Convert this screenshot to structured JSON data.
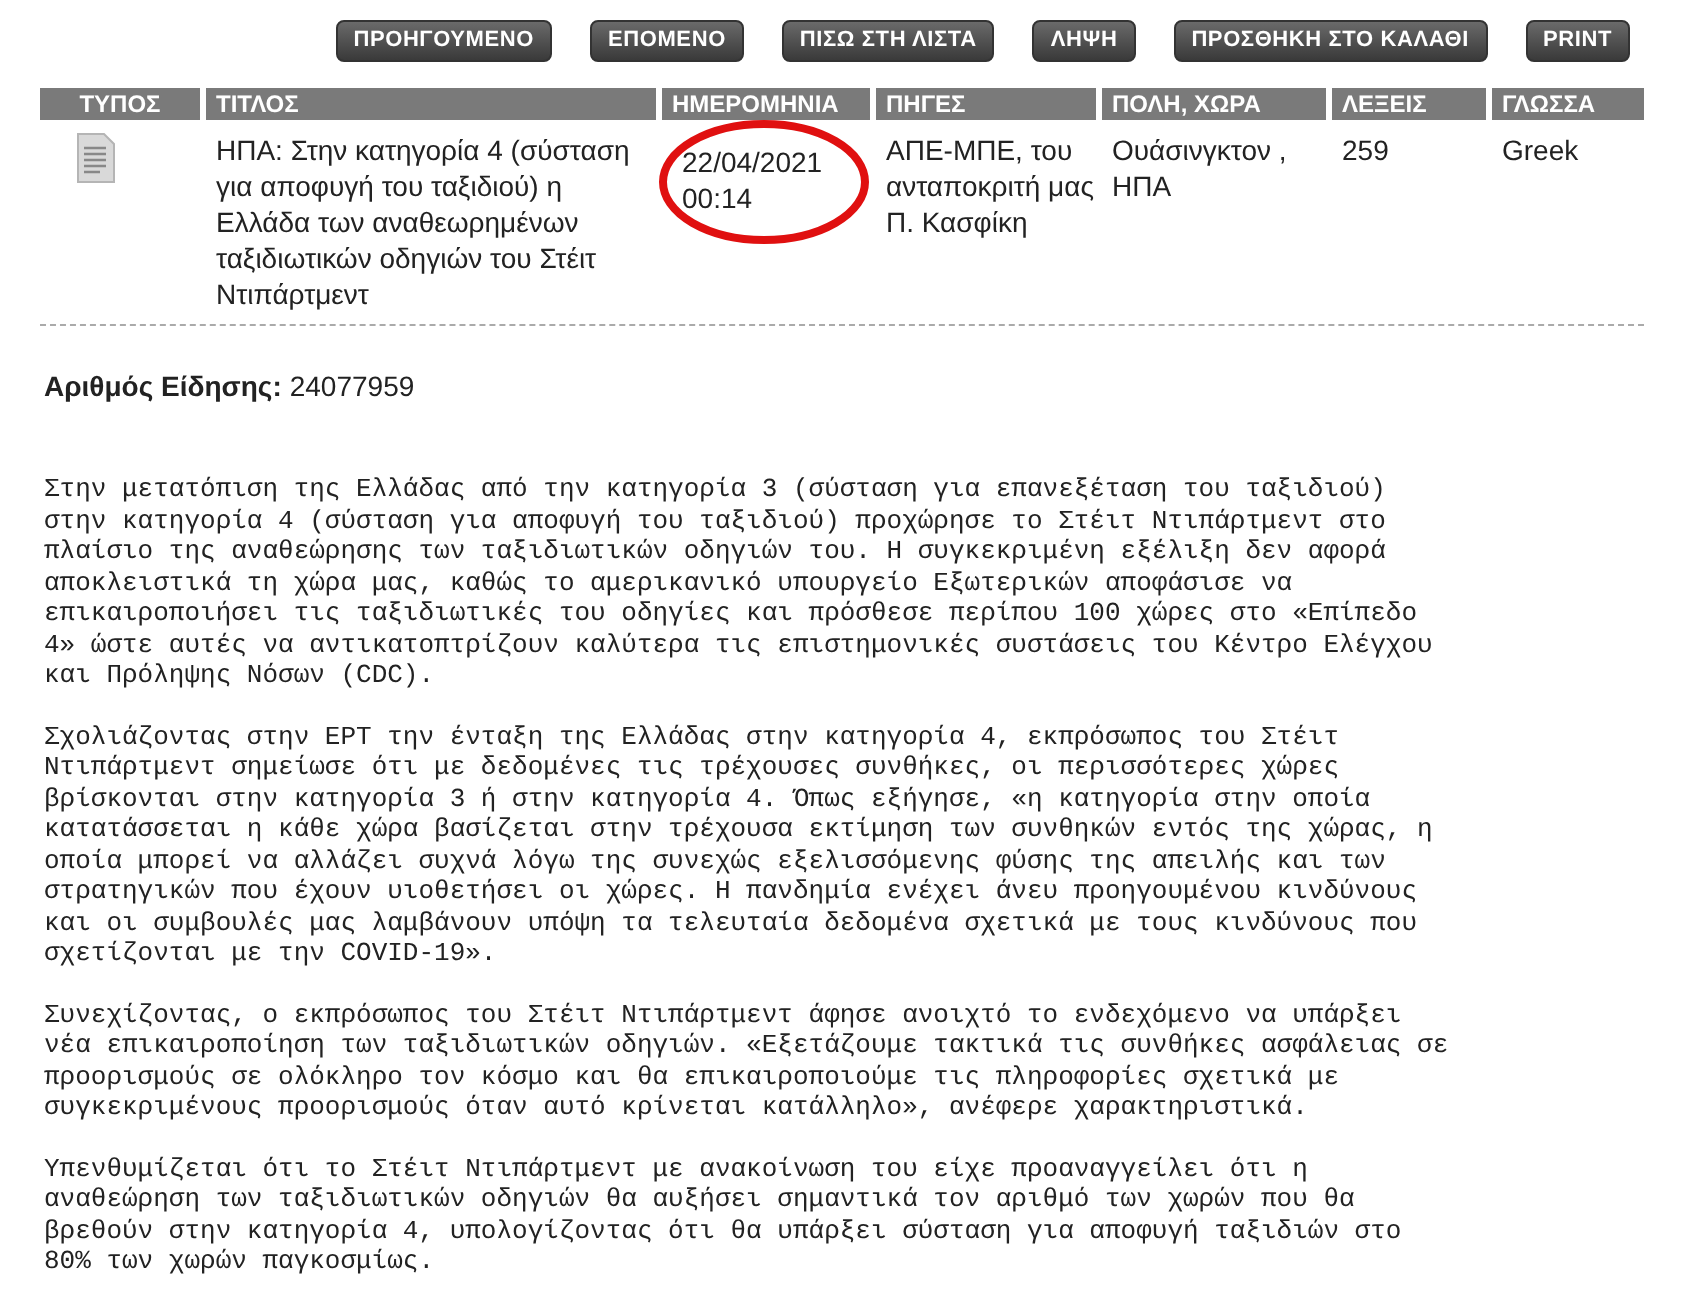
{
  "buttons": [
    "ΠΡΟΗΓΟΥΜΕΝΟ",
    "ΕΠΟΜΕΝΟ",
    "ΠΙΣΩ ΣΤΗ ΛΙΣΤΑ",
    "ΛΗΨΗ",
    "ΠΡΟΣΘΗΚΗ ΣΤΟ ΚΑΛΑΘΙ",
    "PRINT"
  ],
  "table": {
    "columns": [
      "ΤΥΠΟΣ",
      "ΤΙΤΛΟΣ",
      "ΗΜΕΡΟΜΗΝΙΑ",
      "ΠΗΓΕΣ",
      "ΠΟΛΗ, ΧΩΡΑ",
      "ΛΕΞΕΙΣ",
      "ΓΛΩΣΣΑ"
    ],
    "rows": [
      {
        "title": "ΗΠΑ: Στην κατηγορία 4 (σύσταση για αποφυγή του ταξιδιού) η Ελλάδα των αναθεωρημένων ταξιδιωτικών οδηγιών του Στέιτ Ντιπάρτμεντ",
        "date": "22/04/2021 00:14",
        "sources": "ΑΠΕ-ΜΠΕ, του ανταποκριτή μας Π. Κασφίκη",
        "place": "Ουάσινγκτον , ΗΠΑ",
        "words": "259",
        "language": "Greek",
        "circled": true
      }
    ]
  },
  "article": {
    "id_label": "Αριθμός Είδησης:",
    "id_value": "24077959",
    "paragraphs": [
      [
        "Στην μετατόπιση της Ελλάδας από την κατηγορία 3 (σύσταση για επανεξέταση του ταξιδιού)",
        "στην κατηγορία 4 (σύσταση για αποφυγή του ταξιδιού) προχώρησε το Στέιτ Ντιπάρτμεντ στο",
        "πλαίσιο της αναθεώρησης των ταξιδιωτικών οδηγιών του. Η συγκεκριμένη εξέλιξη δεν αφορά",
        "αποκλειστικά τη χώρα μας, καθώς το αμερικανικό υπουργείο Εξωτερικών αποφάσισε να",
        "επικαιροποιήσει τις ταξιδιωτικές του οδηγίες και πρόσθεσε περίπου 100 χώρες στο «Επίπεδο",
        "4» ώστε αυτές να αντικατοπτρίζουν καλύτερα τις επιστημονικές συστάσεις του Κέντρο Ελέγχου",
        "και Πρόληψης Νόσων (CDC)."
      ],
      [
        "Σχολιάζοντας στην ΕΡΤ την ένταξη της Ελλάδας στην κατηγορία 4, εκπρόσωπος του Στέιτ",
        "Ντιπάρτμεντ σημείωσε ότι με δεδομένες τις τρέχουσες συνθήκες, οι περισσότερες χώρες",
        "βρίσκονται στην κατηγορία 3 ή στην κατηγορία 4. Όπως εξήγησε, «η κατηγορία στην οποία",
        "κατατάσσεται η κάθε χώρα βασίζεται στην τρέχουσα εκτίμηση των συνθηκών εντός της χώρας, η",
        "οποία μπορεί να αλλάζει συχνά λόγω της συνεχώς εξελισσόμενης φύσης της απειλής και των",
        "στρατηγικών που έχουν υιοθετήσει οι χώρες. Η πανδημία ενέχει άνευ προηγουμένου κινδύνους",
        "και οι συμβουλές μας λαμβάνουν υπόψη τα τελευταία δεδομένα σχετικά με τους κινδύνους που",
        "σχετίζονται με την COVID-19»."
      ],
      [
        "Συνεχίζοντας, ο εκπρόσωπος του Στέιτ Ντιπάρτμεντ άφησε ανοιχτό το ενδεχόμενο να υπάρξει",
        "νέα επικαιροποίηση των ταξιδιωτικών οδηγιών. «Εξετάζουμε τακτικά τις συνθήκες ασφάλειας σε",
        "προορισμούς σε ολόκληρο τον κόσμο και θα επικαιροποιούμε τις πληροφορίες σχετικά με",
        "συγκεκριμένους προορισμούς όταν αυτό κρίνεται κατάλληλο», ανέφερε χαρακτηριστικά."
      ],
      [
        "Υπενθυμίζεται ότι το Στέιτ Ντιπάρτμεντ με ανακοίνωση του είχε προαναγγείλει ότι η",
        "αναθεώρηση των ταξιδιωτικών οδηγιών θα αυξήσει σημαντικά τον αριθμό των χωρών που θα",
        "βρεθούν στην κατηγορία 4, υπολογίζοντας ότι θα υπάρξει σύσταση για αποφυγή ταξιδιών στο",
        "80% των χωρών παγκοσμίως."
      ]
    ]
  }
}
